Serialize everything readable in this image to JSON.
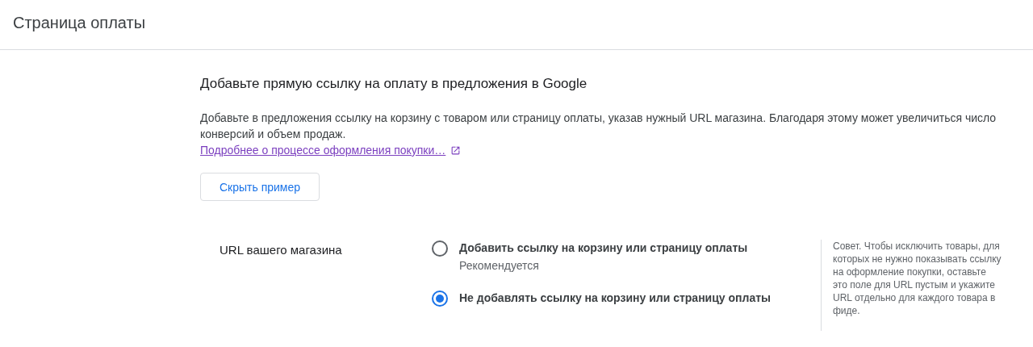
{
  "header": {
    "title": "Страница оплаты"
  },
  "section": {
    "heading": "Добавьте прямую ссылку на оплату в предложения в Google",
    "description": "Добавьте в предложения ссылку на корзину с товаром или страницу оплаты, указав нужный URL магазина. Благодаря этому может увеличиться число конверсий и объем продаж.",
    "link": "Подробнее о процессе оформления покупки…",
    "button": "Скрыть пример"
  },
  "form": {
    "label": "URL вашего магазина",
    "options": [
      {
        "label": "Добавить ссылку на корзину или страницу оплаты",
        "hint": "Рекомендуется",
        "selected": false
      },
      {
        "label": "Не добавлять ссылку на корзину или страницу оплаты",
        "selected": true
      }
    ],
    "tip": "Совет. Чтобы исключить товары, для которых не нужно показывать ссылку на оформление покупки, оставьте это поле для URL пустым и укажите URL отдельно для каждого товара в фиде."
  }
}
